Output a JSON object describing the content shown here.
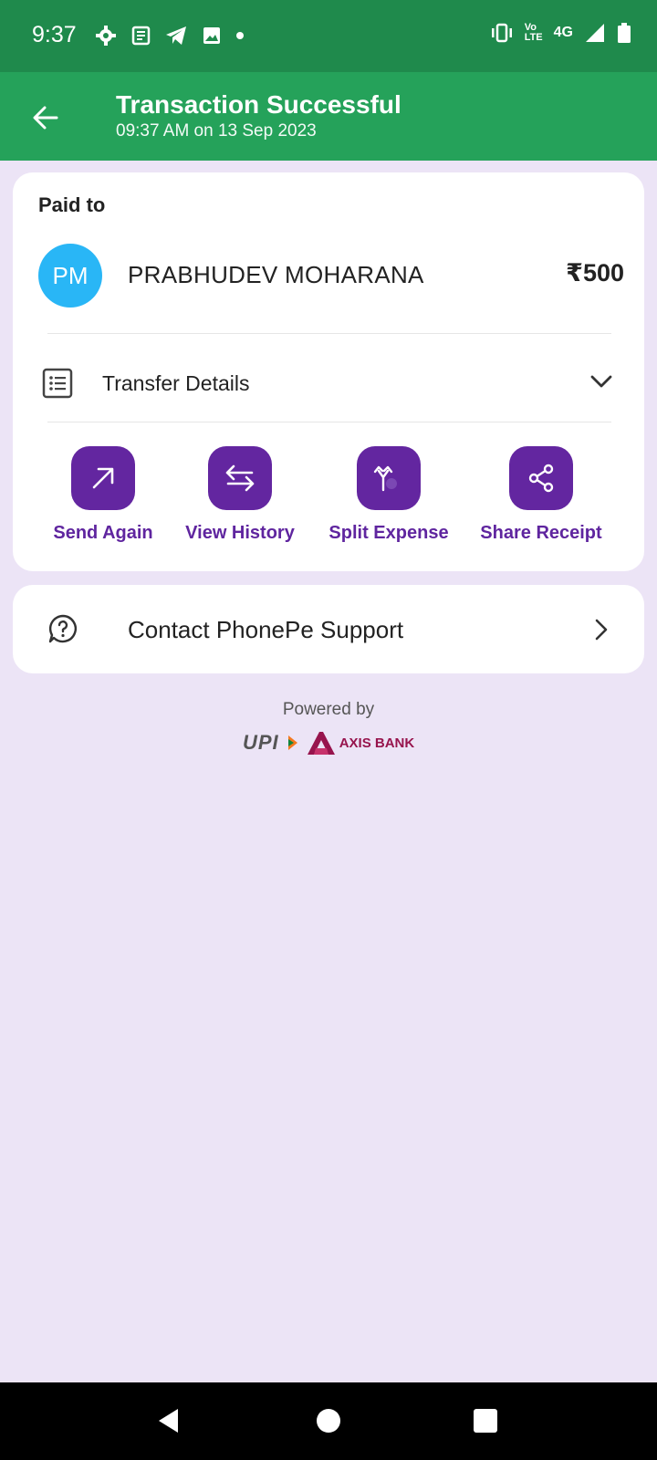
{
  "status_bar": {
    "time": "9:37",
    "network_top": "Vo",
    "network_bottom": "LTE",
    "signal_type": "4G"
  },
  "app_bar": {
    "title": "Transaction Successful",
    "subtitle": "09:37 AM on 13 Sep 2023"
  },
  "payment": {
    "paid_to_label": "Paid to",
    "avatar_initials": "PM",
    "payee_name": "PRABHUDEV MOHARANA",
    "amount": "₹500"
  },
  "transfer_details": {
    "label": "Transfer Details"
  },
  "actions": [
    {
      "label": "Send Again",
      "icon": "arrow-up-right-icon"
    },
    {
      "label": "View History",
      "icon": "swap-arrows-icon"
    },
    {
      "label": "Split Expense",
      "icon": "split-arrows-icon"
    },
    {
      "label": "Share Receipt",
      "icon": "share-icon"
    }
  ],
  "support": {
    "label": "Contact PhonePe Support"
  },
  "footer": {
    "powered_by": "Powered by",
    "upi_logo_text": "UPI",
    "bank_name": "AXIS BANK"
  },
  "colors": {
    "status_bar": "#1f8a4c",
    "app_bar": "#25a25a",
    "background": "#ece4f6",
    "accent_purple": "#5f259f",
    "avatar": "#29b6f6",
    "axis_brand": "#97144d"
  }
}
